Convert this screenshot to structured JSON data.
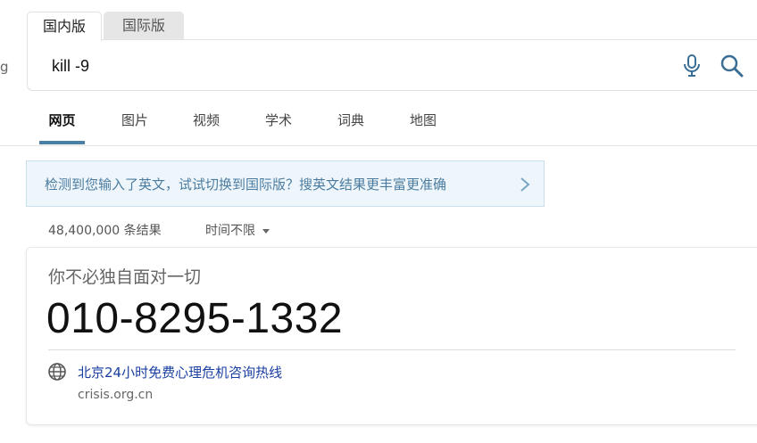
{
  "edge_fragment": "g",
  "version_tabs": {
    "domestic": "国内版",
    "international": "国际版"
  },
  "search": {
    "query": "kill -9"
  },
  "scopes": [
    "网页",
    "图片",
    "视频",
    "学术",
    "词典",
    "地图"
  ],
  "notice": {
    "text": "检测到您输入了英文，试试切换到国际版？搜英文结果更丰富更准确"
  },
  "results_meta": {
    "count": "48,400,000 条结果",
    "time_filter": "时间不限"
  },
  "card": {
    "subtitle": "你不必独自面对一切",
    "number": "010-8295-1332",
    "link_title": "北京24小时免费心理危机咨询热线",
    "domain": "crisis.org.cn"
  },
  "colors": {
    "accent": "#4a7fa6",
    "link": "#1a3fa0",
    "notice_bg": "#eef6fb"
  }
}
